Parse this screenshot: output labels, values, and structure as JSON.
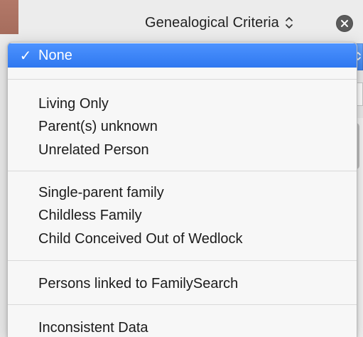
{
  "header": {
    "popup_label": "Genealogical Criteria",
    "popup_icon": "updown-chevron-icon",
    "close_icon": "close-circle-icon"
  },
  "menu": {
    "selected_index": 0,
    "sections": [
      {
        "items": [
          {
            "label": "None",
            "selected": true
          }
        ]
      },
      {
        "items": [
          {
            "label": "Living Only"
          },
          {
            "label": "Parent(s) unknown"
          },
          {
            "label": "Unrelated Person"
          }
        ]
      },
      {
        "items": [
          {
            "label": "Single-parent family"
          },
          {
            "label": "Childless Family"
          },
          {
            "label": "Child Conceived Out of Wedlock"
          }
        ]
      },
      {
        "items": [
          {
            "label": "Persons linked to FamilySearch"
          }
        ]
      },
      {
        "items": [
          {
            "label": "Inconsistent Data"
          }
        ]
      }
    ]
  },
  "colors": {
    "selection_blue": "#3B82F6",
    "menu_background": "#F7F7F7",
    "separator": "#D9D9D9",
    "text": "#1B1B1B"
  }
}
